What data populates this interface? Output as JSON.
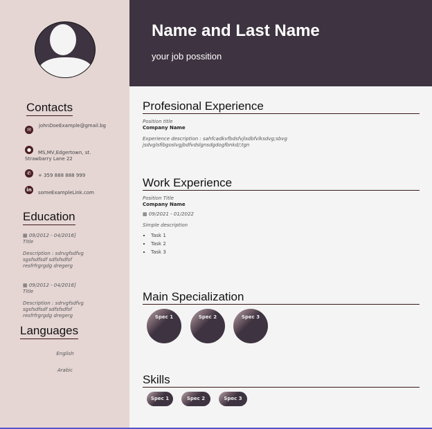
{
  "header": {
    "name": "Name and Last Name",
    "job": "your job possition"
  },
  "sidebar": {
    "contacts_title": "Contacts",
    "contacts": [
      {
        "icon": "envelope-icon",
        "text": "johnDoeExample@gmail.bg"
      },
      {
        "icon": "location-pin-icon",
        "text": "MS,MV,Edgertown, st. Strawbarry Lane 22"
      },
      {
        "icon": "phone-icon",
        "text": "+ 359 888 888 999"
      },
      {
        "icon": "linkedin-icon",
        "text": "someExampleLink.com"
      }
    ],
    "education_title": "Education",
    "education": [
      {
        "dates": "09/2012 - 04/2016]",
        "title": "Title",
        "description": "Description : sdrvgfsdfvg sgsfsdfsdf sdfsfsdfsf resfrfrgrgdg dregerg"
      },
      {
        "dates": "09/2012 - 04/2016]",
        "title": "Title",
        "description": "Description : sdrvgfsdfvg sgsfsdfsdf sdfsfsdfsf resfrfrgrgdg dregerg"
      }
    ],
    "languages_title": "Languages",
    "languages": [
      "English",
      "Arabic"
    ]
  },
  "main": {
    "prof": {
      "title": "Profesional Experience",
      "position": "Position title",
      "company": "Company Name",
      "description": "Experience description : sahfcadkvfbdsfvjlsdbfvlksdvg;sbvg jsdvglsfibgoslvgjbdfvdslgnsdgdogfbnkd/;tgn"
    },
    "work": {
      "title": "Work Experience",
      "position": "Position Title",
      "company": "Company Name",
      "dates": "09/2021 - 01/2022",
      "description": "Simple description",
      "tasks": [
        "Task 1",
        "Task 2",
        "Task 3"
      ]
    },
    "spec": {
      "title": "Main Specialization",
      "items": [
        "Spec 1",
        "Spec 2",
        "Spec 3"
      ]
    },
    "skills": {
      "title": "Skills",
      "items": [
        "Spec 1",
        "Spec 2",
        "Spec 3"
      ]
    }
  },
  "colors": {
    "sidebar": "#e5d6d4",
    "header": "#3e3340",
    "accent": "#4a1e22"
  }
}
